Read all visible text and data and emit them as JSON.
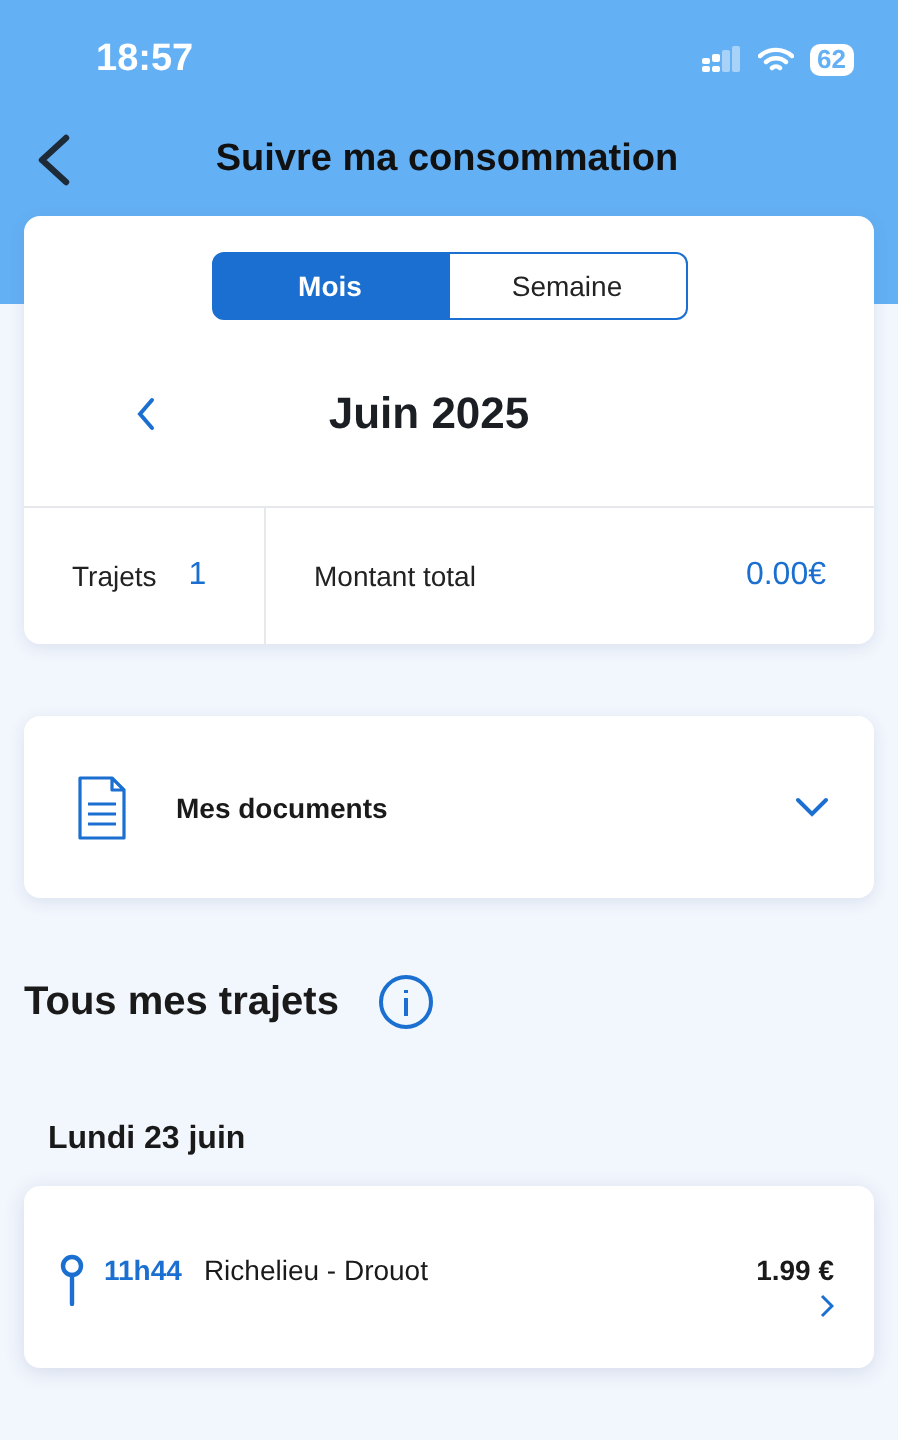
{
  "status_bar": {
    "time": "18:57",
    "battery": "62"
  },
  "header": {
    "title": "Suivre ma consommation"
  },
  "period": {
    "tabs": [
      {
        "label": "Mois",
        "selected": true
      },
      {
        "label": "Semaine",
        "selected": false
      }
    ],
    "month": "Juin 2025",
    "stats": {
      "trips_label": "Trajets",
      "trips_count": "1",
      "total_label": "Montant total",
      "total_value": "0.00€"
    }
  },
  "documents": {
    "label": "Mes documents",
    "expanded": false
  },
  "trips": {
    "title": "Tous mes trajets",
    "days": [
      {
        "date": "Lundi 23 juin",
        "trips": [
          {
            "time": "11h44",
            "route": "Richelieu - Drouot",
            "price": "1.99 €"
          }
        ]
      }
    ]
  }
}
